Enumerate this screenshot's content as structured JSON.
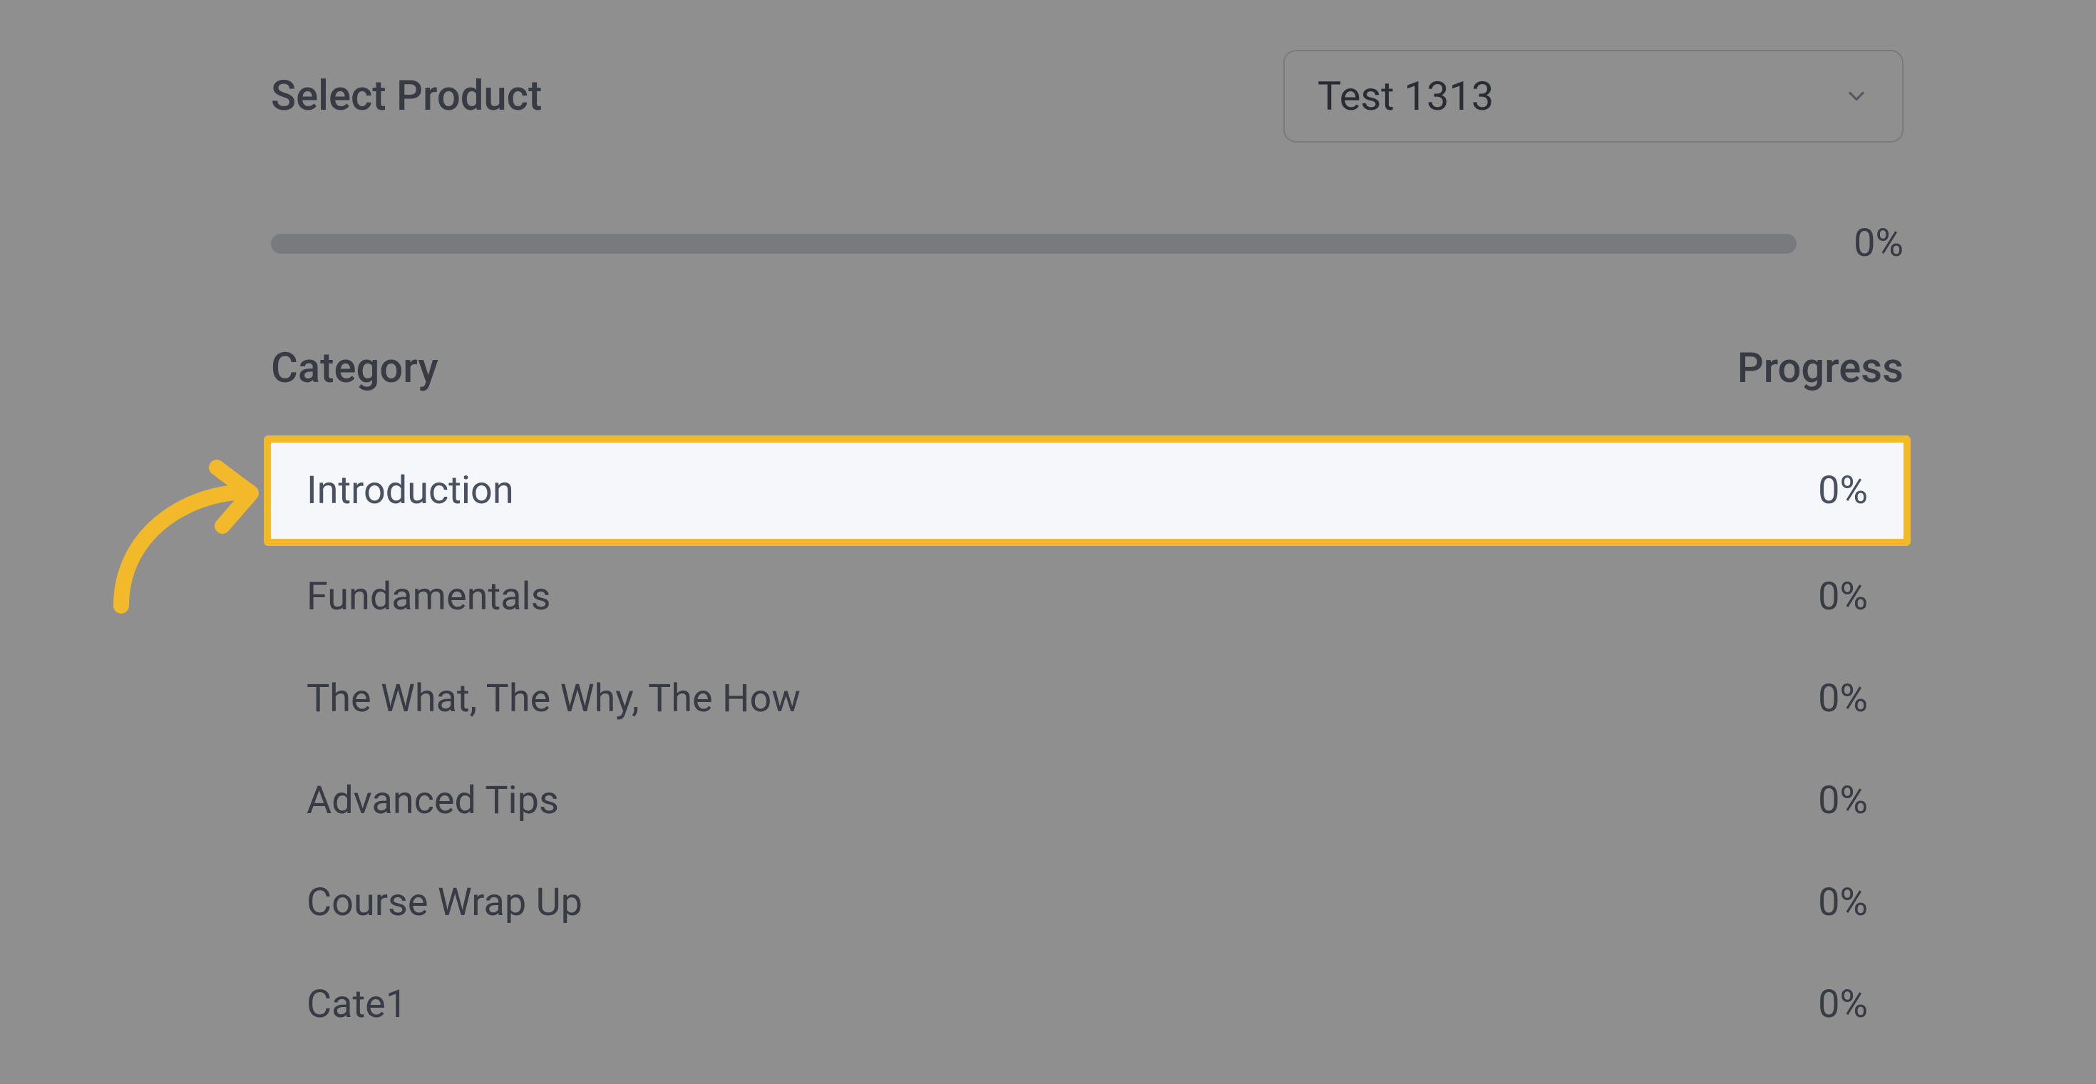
{
  "selector": {
    "label": "Select Product",
    "selected": "Test 1313"
  },
  "progress": {
    "overall_percent_label": "0%",
    "overall_percent_value": 0
  },
  "columns": {
    "category": "Category",
    "progress": "Progress"
  },
  "categories": [
    {
      "name": "Introduction",
      "progress": "0%",
      "highlighted": true
    },
    {
      "name": "Fundamentals",
      "progress": "0%",
      "highlighted": false
    },
    {
      "name": "The What, The Why, The How",
      "progress": "0%",
      "highlighted": false
    },
    {
      "name": "Advanced Tips",
      "progress": "0%",
      "highlighted": false
    },
    {
      "name": "Course Wrap Up",
      "progress": "0%",
      "highlighted": false
    },
    {
      "name": "Cate1",
      "progress": "0%",
      "highlighted": false
    }
  ],
  "annotation": {
    "highlight_color": "#f2b92a",
    "arrow_color": "#f2b92a"
  }
}
